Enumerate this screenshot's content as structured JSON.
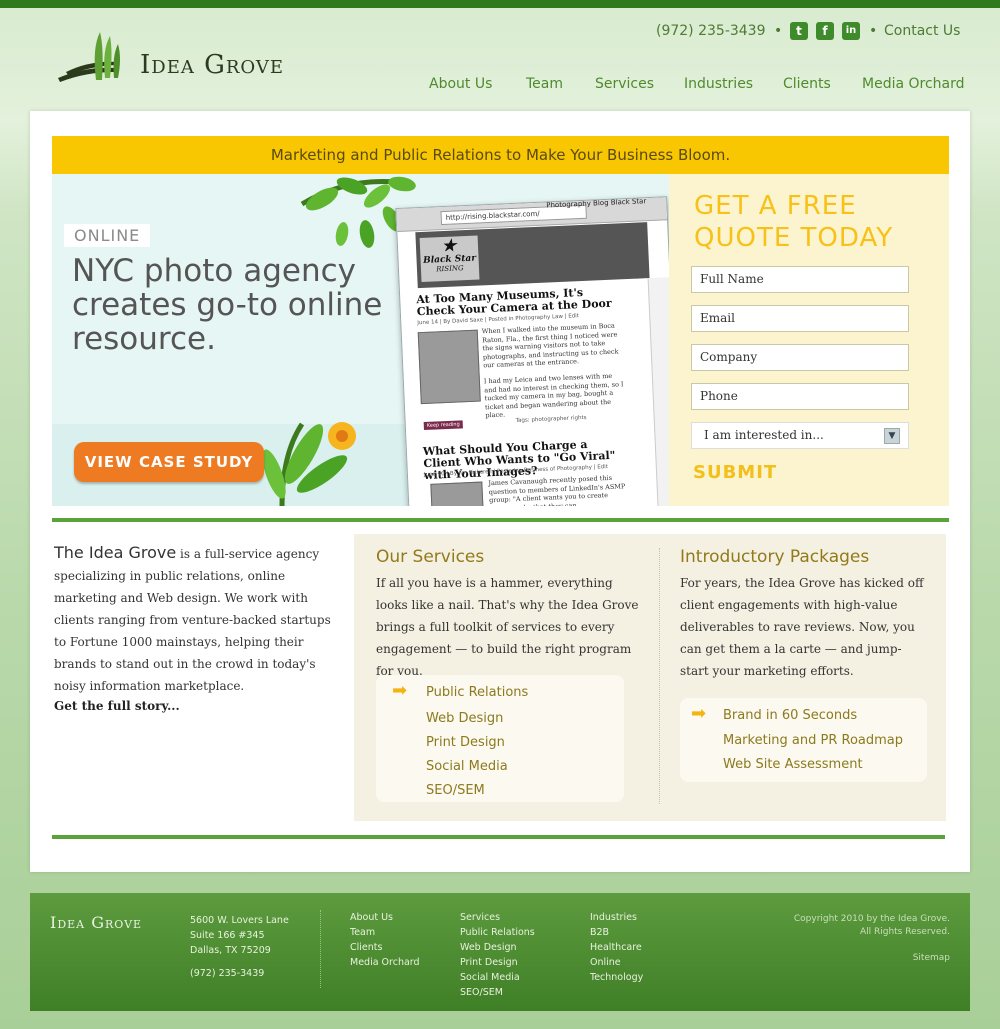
{
  "header": {
    "brand": "Idea Grove",
    "phone": "(972) 235-3439",
    "separator": "•",
    "social": {
      "twitter": "t",
      "facebook": "f",
      "linkedin": "in"
    },
    "contact": "Contact Us",
    "nav": [
      "About Us",
      "Team",
      "Services",
      "Industries",
      "Clients",
      "Media Orchard"
    ]
  },
  "tagline": "Marketing and Public Relations to Make Your Business Bloom.",
  "hero": {
    "eyebrow": "ONLINE",
    "title": "NYC photo agency creates go-to online resource.",
    "cta": "VIEW CASE STUDY",
    "screenshot": {
      "url": "http://rising.blackstar.com/",
      "window_title": "Photography Blog Black Star",
      "logo_top": "Black Star",
      "logo_bottom": "RISING",
      "post1_title": "At Too Many Museums, It's Check Your Camera at the Door",
      "post1_meta": "June 14 | By David Saxe | Posted in Photography Law | Edit",
      "post1_text": "When I walked into the museum in Boca Raton, Fla., the first thing I noticed were the signs warning visitors not to take photographs, and instructing us to check our cameras at the entrance.",
      "post1_text2": "I had my Leica and two lenses with me and had no interest in checking them, so I tucked my camera in my bag, bought a ticket and began wandering about the place.",
      "keep_reading": "Keep reading",
      "tags": "Tags: photographer rights",
      "post2_title": "What Should You Charge a Client Who Wants to \"Go Viral\" with Your Images?",
      "post2_meta": "June 10 | By Jim Pickerell | Posted in Business of Photography | Edit",
      "post2_text": "James Cavanaugh recently posed this question to members of LinkedIn's ASMP group: \"A client wants you to create photographs that they can"
    }
  },
  "quote": {
    "heading_line1": "GET A FREE",
    "heading_line2": "QUOTE TODAY",
    "full_name": "Full Name",
    "email": "Email",
    "company": "Company",
    "phone": "Phone",
    "interest": "I am interested in...",
    "submit": "SUBMIT"
  },
  "intro": {
    "lead": "The Idea Grove",
    "text": "is a full-service agency specializing in public relations, online marketing and Web design. We work with clients ranging from venture-backed startups to Fortune 1000 mainstays, helping their brands to stand out in the crowd in today's noisy information marketplace.",
    "more": "Get the full story..."
  },
  "services": {
    "heading": "Our Services",
    "text": "If all you have is a hammer, everything looks like a nail. That's why the Idea Grove brings a full toolkit of services to every engagement — to build the right program for you.",
    "items": [
      "Public Relations",
      "Web Design",
      "Print Design",
      "Social Media",
      "SEO/SEM"
    ]
  },
  "packages": {
    "heading": "Introductory Packages",
    "text": "For years, the Idea Grove has kicked off client engagements with high-value deliverables to rave reviews. Now, you can get them a la carte — and jump-start your marketing efforts.",
    "items": [
      "Brand in 60 Seconds",
      "Marketing and PR Roadmap",
      "Web Site Assessment"
    ]
  },
  "footer": {
    "brand": "Idea Grove",
    "address1": "5600 W. Lovers Lane",
    "address2": "Suite 166 #345",
    "address3": "Dallas, TX 75209",
    "phone": "(972) 235-3439",
    "col1": [
      "About Us",
      "Team",
      "Clients",
      "Media Orchard"
    ],
    "col2": [
      "Services",
      "Public Relations",
      "Web Design",
      "Print Design",
      "Social Media",
      "SEO/SEM"
    ],
    "col3": [
      "Industries",
      "B2B",
      "Healthcare",
      "Online",
      "Technology"
    ],
    "copyright1": "Copyright 2010 by the Idea Grove.",
    "copyright2": "All Rights Reserved.",
    "sitemap": "Sitemap"
  }
}
